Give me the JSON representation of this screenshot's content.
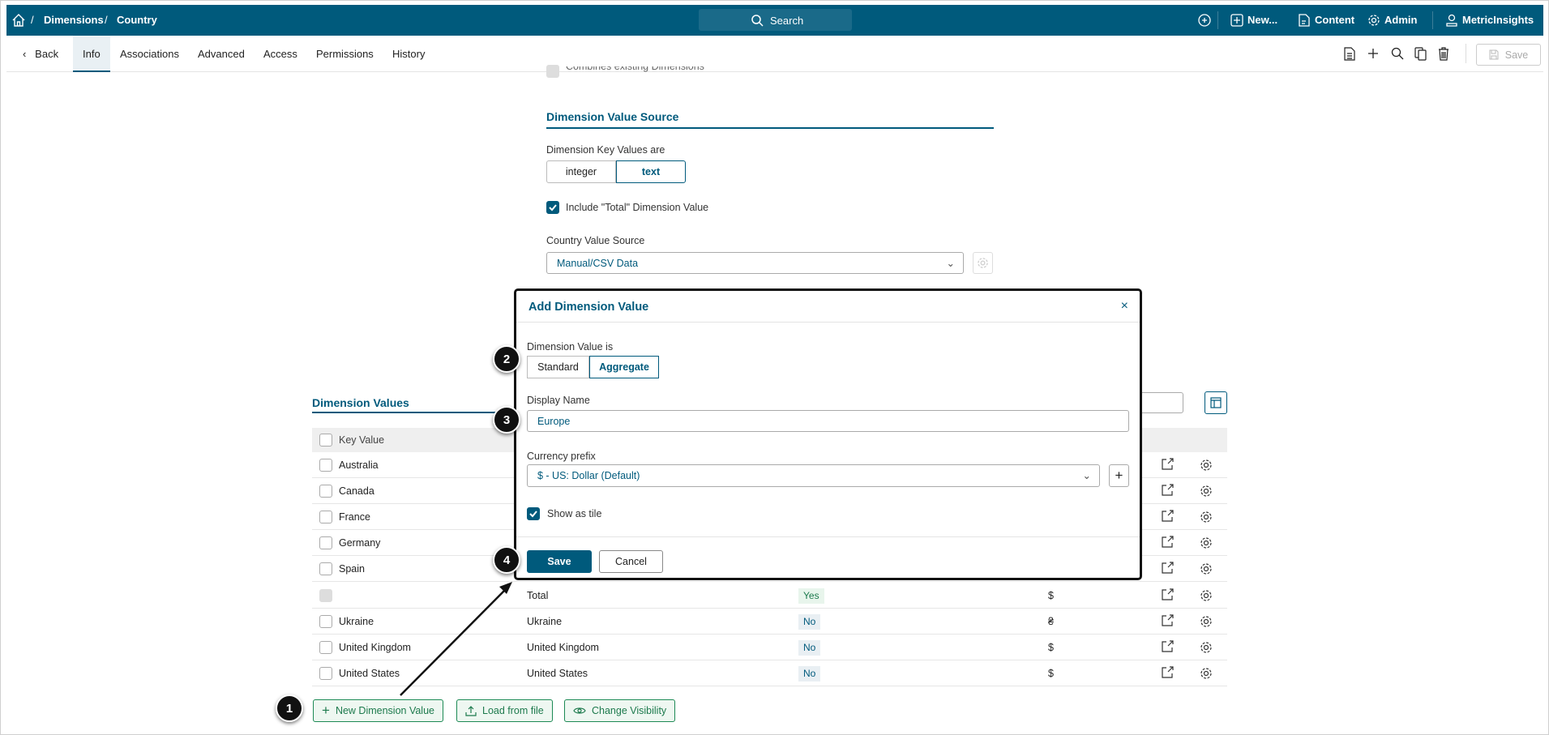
{
  "topbar": {
    "breadcrumb": [
      "Dimensions",
      "Country"
    ],
    "search_label": "Search",
    "new_label": "New...",
    "content_label": "Content",
    "admin_label": "Admin",
    "user_label": "MetricInsights"
  },
  "tabs": {
    "back": "Back",
    "items": [
      "Info",
      "Associations",
      "Advanced",
      "Access",
      "Permissions",
      "History"
    ],
    "active": "Info",
    "save_label": "Save"
  },
  "form": {
    "combines_label": "Combines existing Dimensions",
    "section_title": "Dimension Value Source",
    "key_values_label": "Dimension Key Values are",
    "key_options": [
      "integer",
      "text"
    ],
    "key_selected": "text",
    "include_total_label": "Include \"Total\" Dimension Value",
    "include_total_checked": true,
    "source_label": "Country Value Source",
    "source_value": "Manual/CSV Data"
  },
  "modal": {
    "title": "Add Dimension Value",
    "value_is_label": "Dimension Value is",
    "value_options": [
      "Standard",
      "Aggregate"
    ],
    "value_selected": "Aggregate",
    "display_name_label": "Display Name",
    "display_name_value": "Europe",
    "currency_label": "Currency prefix",
    "currency_value": "$ - US: Dollar (Default)",
    "show_tile_label": "Show as tile",
    "show_tile_checked": true,
    "save_label": "Save",
    "cancel_label": "Cancel"
  },
  "table": {
    "title": "Dimension Values",
    "header_key": "Key Value",
    "rows": [
      {
        "key": "Australia",
        "display": "",
        "visible": "",
        "currency": ""
      },
      {
        "key": "Canada",
        "display": "",
        "visible": "",
        "currency": ""
      },
      {
        "key": "France",
        "display": "",
        "visible": "",
        "currency": ""
      },
      {
        "key": "Germany",
        "display": "",
        "visible": "",
        "currency": ""
      },
      {
        "key": "Spain",
        "display": "",
        "visible": "",
        "currency": ""
      },
      {
        "key": "",
        "display": "Total",
        "visible": "Yes",
        "currency": "$"
      },
      {
        "key": "Ukraine",
        "display": "Ukraine",
        "visible": "No",
        "currency": "₴"
      },
      {
        "key": "United Kingdom",
        "display": "United Kingdom",
        "visible": "No",
        "currency": "$"
      },
      {
        "key": "United States",
        "display": "United States",
        "visible": "No",
        "currency": "$"
      }
    ]
  },
  "actions": {
    "new_label": "New Dimension Value",
    "load_label": "Load from file",
    "visibility_label": "Change Visibility"
  },
  "callouts": [
    "1",
    "2",
    "3",
    "4"
  ],
  "colors": {
    "brand": "#005a7c",
    "green": "#1d7a4d"
  }
}
